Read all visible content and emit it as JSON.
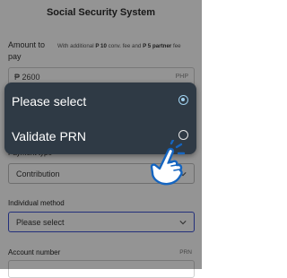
{
  "header": {
    "title": "Social Security System"
  },
  "amount": {
    "label": "Amount to pay",
    "note_prefix": "With additional ",
    "note_fee1": "P 10",
    "note_mid": " conv. fee and ",
    "note_fee2": "P 5 partner",
    "note_suffix": " fee",
    "value": "₱  2600",
    "currency": "PHP"
  },
  "payment_type": {
    "label": "Payment type",
    "value": "Contribution"
  },
  "individual_method": {
    "label": "Individual method",
    "value": "Please select"
  },
  "account_number": {
    "label": "Account number",
    "tag": "PRN"
  },
  "dropdown": {
    "options": [
      {
        "label": "Please select",
        "selected": true
      },
      {
        "label": "Validate PRN",
        "selected": false
      }
    ]
  },
  "colors": {
    "menu_bg": "#2f3a45",
    "radio_accent": "#9fd0ee",
    "focus_border": "#3d52d5",
    "hand_outline": "#1565c0"
  },
  "icons": {
    "pointer": "hand-pointer-icon",
    "chevron": "chevron-down-icon"
  }
}
